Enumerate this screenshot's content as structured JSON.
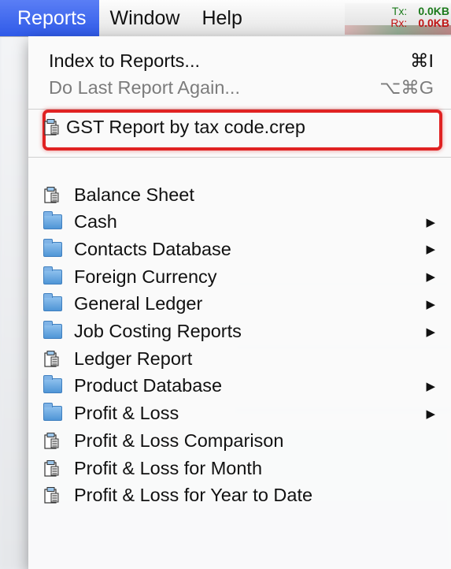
{
  "menubar": {
    "items": [
      {
        "label": "Reports"
      },
      {
        "label": "Window"
      },
      {
        "label": "Help"
      }
    ],
    "network": {
      "tx_label": "Tx:",
      "tx_value": "0.0KB",
      "rx_label": "Rx:",
      "rx_value": "0.0KB"
    }
  },
  "menu": {
    "index": {
      "label": "Index to Reports...",
      "shortcut": "⌘I"
    },
    "do_last": {
      "label": "Do Last Report Again...",
      "shortcut": "⌥⌘G"
    },
    "recent_report": {
      "label": "GST Report by tax code.crep",
      "icon": "report-document-icon"
    },
    "items": [
      {
        "label": "Balance Sheet",
        "icon": "report-document-icon",
        "submenu": false
      },
      {
        "label": "Cash",
        "icon": "folder-icon",
        "submenu": true
      },
      {
        "label": "Contacts Database",
        "icon": "folder-icon",
        "submenu": true
      },
      {
        "label": "Foreign Currency",
        "icon": "folder-icon",
        "submenu": true
      },
      {
        "label": "General Ledger",
        "icon": "folder-icon",
        "submenu": true
      },
      {
        "label": "Job Costing Reports",
        "icon": "folder-icon",
        "submenu": true
      },
      {
        "label": "Ledger Report",
        "icon": "report-document-icon",
        "submenu": false
      },
      {
        "label": "Product Database",
        "icon": "folder-icon",
        "submenu": true
      },
      {
        "label": "Profit & Loss",
        "icon": "folder-icon",
        "submenu": true
      },
      {
        "label": "Profit & Loss Comparison",
        "icon": "report-document-icon",
        "submenu": false
      },
      {
        "label": "Profit & Loss for Month",
        "icon": "report-document-icon",
        "submenu": false
      },
      {
        "label": "Profit & Loss for Year to Date",
        "icon": "report-document-icon",
        "submenu": false
      }
    ],
    "submenu_arrow": "▶"
  },
  "colors": {
    "menubar_active": "#3a64ee",
    "highlight_border": "#e02222"
  }
}
